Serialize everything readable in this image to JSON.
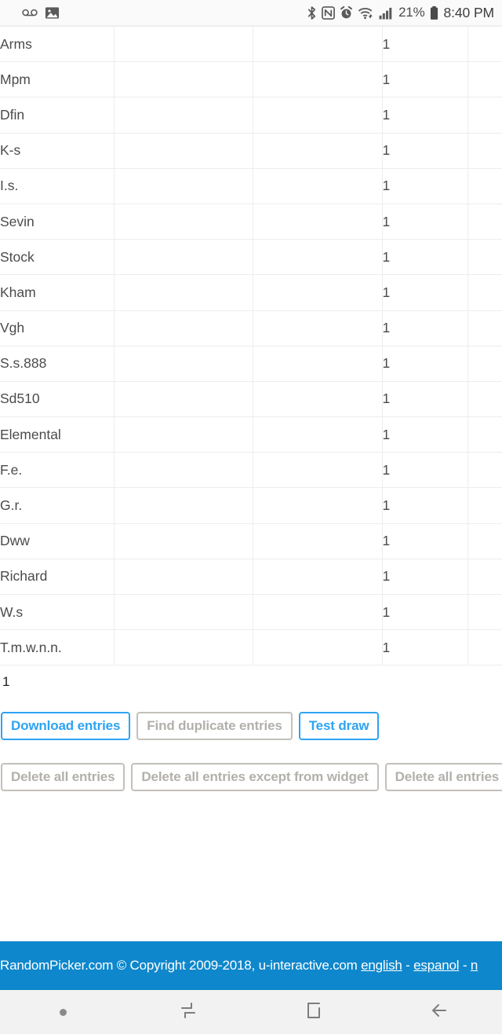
{
  "statusbar": {
    "left_icons": [
      {
        "name": "voicemail-icon",
        "glyph": "⚇"
      },
      {
        "name": "screenshot-image-icon",
        "glyph": "🖼"
      }
    ],
    "right_icons": [
      {
        "name": "bluetooth-icon"
      },
      {
        "name": "nfc-icon"
      },
      {
        "name": "alarm-icon"
      },
      {
        "name": "wifi-icon"
      },
      {
        "name": "cellular-signal-icon"
      }
    ],
    "battery_percent": "21%",
    "time": "8:40 PM"
  },
  "table": {
    "columns": [
      "name",
      "blank_1",
      "blank_2",
      "count",
      "blank_3"
    ],
    "rows": [
      {
        "name": "Arms",
        "b": "",
        "c": "",
        "count": "1",
        "e": ""
      },
      {
        "name": "Mpm",
        "b": "",
        "c": "",
        "count": "1",
        "e": ""
      },
      {
        "name": "Dfin",
        "b": "",
        "c": "",
        "count": "1",
        "e": ""
      },
      {
        "name": "K-s",
        "b": "",
        "c": "",
        "count": "1",
        "e": ""
      },
      {
        "name": "I.s.",
        "b": "",
        "c": "",
        "count": "1",
        "e": ""
      },
      {
        "name": "Sevin",
        "b": "",
        "c": "",
        "count": "1",
        "e": ""
      },
      {
        "name": "Stock",
        "b": "",
        "c": "",
        "count": "1",
        "e": ""
      },
      {
        "name": "Kham",
        "b": "",
        "c": "",
        "count": "1",
        "e": ""
      },
      {
        "name": "Vgh",
        "b": "",
        "c": "",
        "count": "1",
        "e": ""
      },
      {
        "name": "S.s.888",
        "b": "",
        "c": "",
        "count": "1",
        "e": ""
      },
      {
        "name": "Sd510",
        "b": "",
        "c": "",
        "count": "1",
        "e": ""
      },
      {
        "name": "Elemental",
        "b": "",
        "c": "",
        "count": "1",
        "e": ""
      },
      {
        "name": "F.e.",
        "b": "",
        "c": "",
        "count": "1",
        "e": ""
      },
      {
        "name": "G.r.",
        "b": "",
        "c": "",
        "count": "1",
        "e": ""
      },
      {
        "name": "Dww",
        "b": "",
        "c": "",
        "count": "1",
        "e": ""
      },
      {
        "name": "Richard",
        "b": "",
        "c": "",
        "count": "1",
        "e": ""
      },
      {
        "name": "W.s",
        "b": "",
        "c": "",
        "count": "1",
        "e": ""
      },
      {
        "name": "T.m.w.n.n.",
        "b": "",
        "c": "",
        "count": "1",
        "e": ""
      }
    ]
  },
  "count_line": "1",
  "actions": {
    "row1": [
      {
        "label": "Download entries",
        "style": "primary"
      },
      {
        "label": "Find duplicate entries",
        "style": "muted"
      },
      {
        "label": "Test draw",
        "style": "primary"
      }
    ],
    "row2": [
      {
        "label": "Delete all entries",
        "style": "muted"
      },
      {
        "label": "Delete all entries except from widget",
        "style": "muted"
      },
      {
        "label": "Delete all entries",
        "style": "muted"
      }
    ]
  },
  "footer": {
    "copyright": "RandomPicker.com © Copyright 2009-2018, u-interactive.com ",
    "lang_english": "english",
    "sep1": " - ",
    "lang_espanol": "espanol",
    "sep2": " - ",
    "lang_truncated": "n"
  },
  "navbar": {
    "buttons": [
      {
        "name": "nav-dot-indicator",
        "label": ""
      },
      {
        "name": "nav-recent-apps",
        "label": ""
      },
      {
        "name": "nav-home",
        "label": ""
      },
      {
        "name": "nav-back",
        "label": ""
      }
    ]
  },
  "colors": {
    "accent_blue": "#2ea3f2",
    "footer_blue": "#0e87cc",
    "muted_gray": "#b3b0ab",
    "nav_bg": "#f2f2f2"
  }
}
